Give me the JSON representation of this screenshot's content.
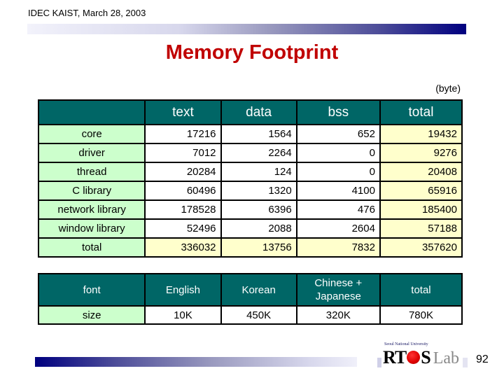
{
  "header": {
    "text": "IDEC KAIST, March 28, 2003"
  },
  "title": "Memory Footprint",
  "unit_label": "(byte)",
  "memory_table": {
    "columns": [
      "",
      "text",
      "data",
      "bss",
      "total"
    ],
    "rows": [
      {
        "label": "core",
        "text": "17216",
        "data": "1564",
        "bss": "652",
        "total": "19432"
      },
      {
        "label": "driver",
        "text": "7012",
        "data": "2264",
        "bss": "0",
        "total": "9276"
      },
      {
        "label": "thread",
        "text": "20284",
        "data": "124",
        "bss": "0",
        "total": "20408"
      },
      {
        "label": "C library",
        "text": "60496",
        "data": "1320",
        "bss": "4100",
        "total": "65916"
      },
      {
        "label": "network library",
        "text": "178528",
        "data": "6396",
        "bss": "476",
        "total": "185400"
      },
      {
        "label": "window library",
        "text": "52496",
        "data": "2088",
        "bss": "2604",
        "total": "57188"
      },
      {
        "label": "total",
        "text": "336032",
        "data": "13756",
        "bss": "7832",
        "total": "357620"
      }
    ]
  },
  "font_table": {
    "columns": [
      "font",
      "English",
      "Korean",
      "Chinese + Japanese",
      "total"
    ],
    "rows": [
      {
        "label": "size",
        "english": "10K",
        "korean": "450K",
        "chinese_japanese": "320K",
        "total": "780K"
      }
    ]
  },
  "logo": {
    "subtitle": "Seoul National University",
    "name_prefix": "RT",
    "name_suffix": "S",
    "lab": "Lab"
  },
  "page_number": "92",
  "colors": {
    "title": "#c00000",
    "header_bg": "#006666",
    "row_label_bg": "#ccffcc",
    "total_bg": "#ffffcc",
    "bar_dark": "#00007f"
  }
}
